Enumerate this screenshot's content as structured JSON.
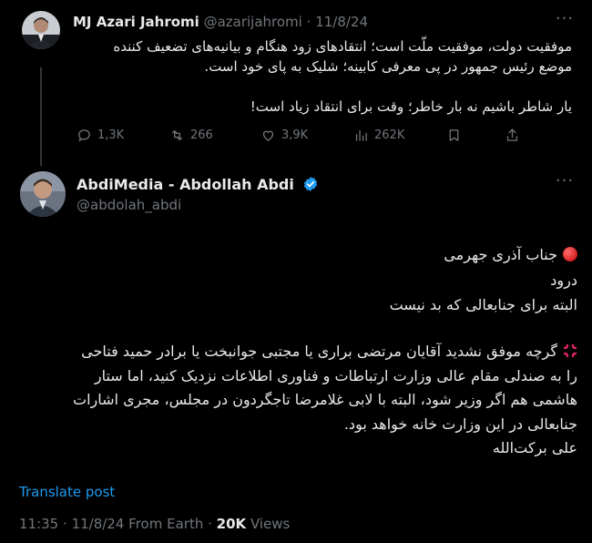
{
  "parent_tweet": {
    "display_name": "MJ Azari Jahromi",
    "handle": "@azarijahromi",
    "separator": "·",
    "date": "11/8/24",
    "lines": [
      "موفقیت دولت، موفقیت ملّت است؛ انتقادهای زود هنگام و بیانیه‌های تضعیف کننده",
      "موضع رئیس جمهور در پی معرفی کابینه؛ شلیک به پای خود است.",
      "یار شاطر باشیم نه بار خاطر؛ وقت برای انتقاد زیاد است!"
    ],
    "actions": {
      "replies": "1,3K",
      "reposts": "266",
      "likes": "3,9K",
      "views": "262K"
    }
  },
  "main_tweet": {
    "display_name": "AbdiMedia - Abdollah Abdi",
    "handle": "@abdolah_abdi",
    "lines": [
      "جناب آذری جهرمی",
      "درود",
      "البته برای جنابعالی که بد نیست",
      "گرچه موفق نشدید آقایان مرتضی براری یا مجتبی جوانبخت یا برادر حمید فتاحی",
      "را به صندلی مقام عالی وزارت ارتباطات و فناوری اطلاعات نزدیک کنید، اما ستار",
      "هاشمی هم اگر وزیر شود، البته با لابی غلامرضا تاجگردون در مجلس، مجری اشارات",
      "جنابعالی در این وزارت خانه خواهد بود.",
      "علی برکت‌الله"
    ],
    "translate_label": "Translate post",
    "time": "11:35",
    "date": "11/8/24",
    "source": "From Earth",
    "views_count": "20K",
    "views_label": "Views"
  },
  "colors": {
    "background": "#000000",
    "text": "#e7e9ea",
    "muted": "#71767b",
    "accent": "#1d9bf0"
  }
}
